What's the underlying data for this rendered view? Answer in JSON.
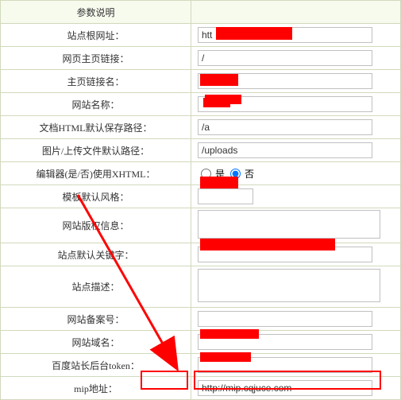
{
  "header": {
    "param_desc": "参数说明"
  },
  "rows": {
    "root_url": {
      "label": "站点根网址：",
      "value": "htt"
    },
    "home_link": {
      "label": "网页主页链接：",
      "value": "/"
    },
    "home_link_name": {
      "label": "主页链接名：",
      "value": ""
    },
    "site_name": {
      "label": "网站名称：",
      "value": ""
    },
    "doc_html_path": {
      "label": "文档HTML默认保存路径：",
      "value": "/a"
    },
    "upload_path": {
      "label": "图片/上传文件默认路径：",
      "value": "/uploads"
    },
    "editor_xhtml": {
      "label": "编辑器(是/否)使用XHTML：",
      "yes": "是",
      "no": "否"
    },
    "default_style": {
      "label": "模板默认风格：",
      "value": ""
    },
    "copyright": {
      "label": "网站版权信息：",
      "value": ""
    },
    "keywords": {
      "label": "站点默认关键字：",
      "value": ""
    },
    "description": {
      "label": "站点描述：",
      "value": ""
    },
    "icp": {
      "label": "网站备案号：",
      "value": ""
    },
    "domain": {
      "label": "网站域名：",
      "value": ""
    },
    "baidu_token": {
      "label": "百度站长后台token：",
      "value": ""
    },
    "mip_url": {
      "label": "mip地址：",
      "value": "http://mip.cqjuce.com"
    }
  }
}
